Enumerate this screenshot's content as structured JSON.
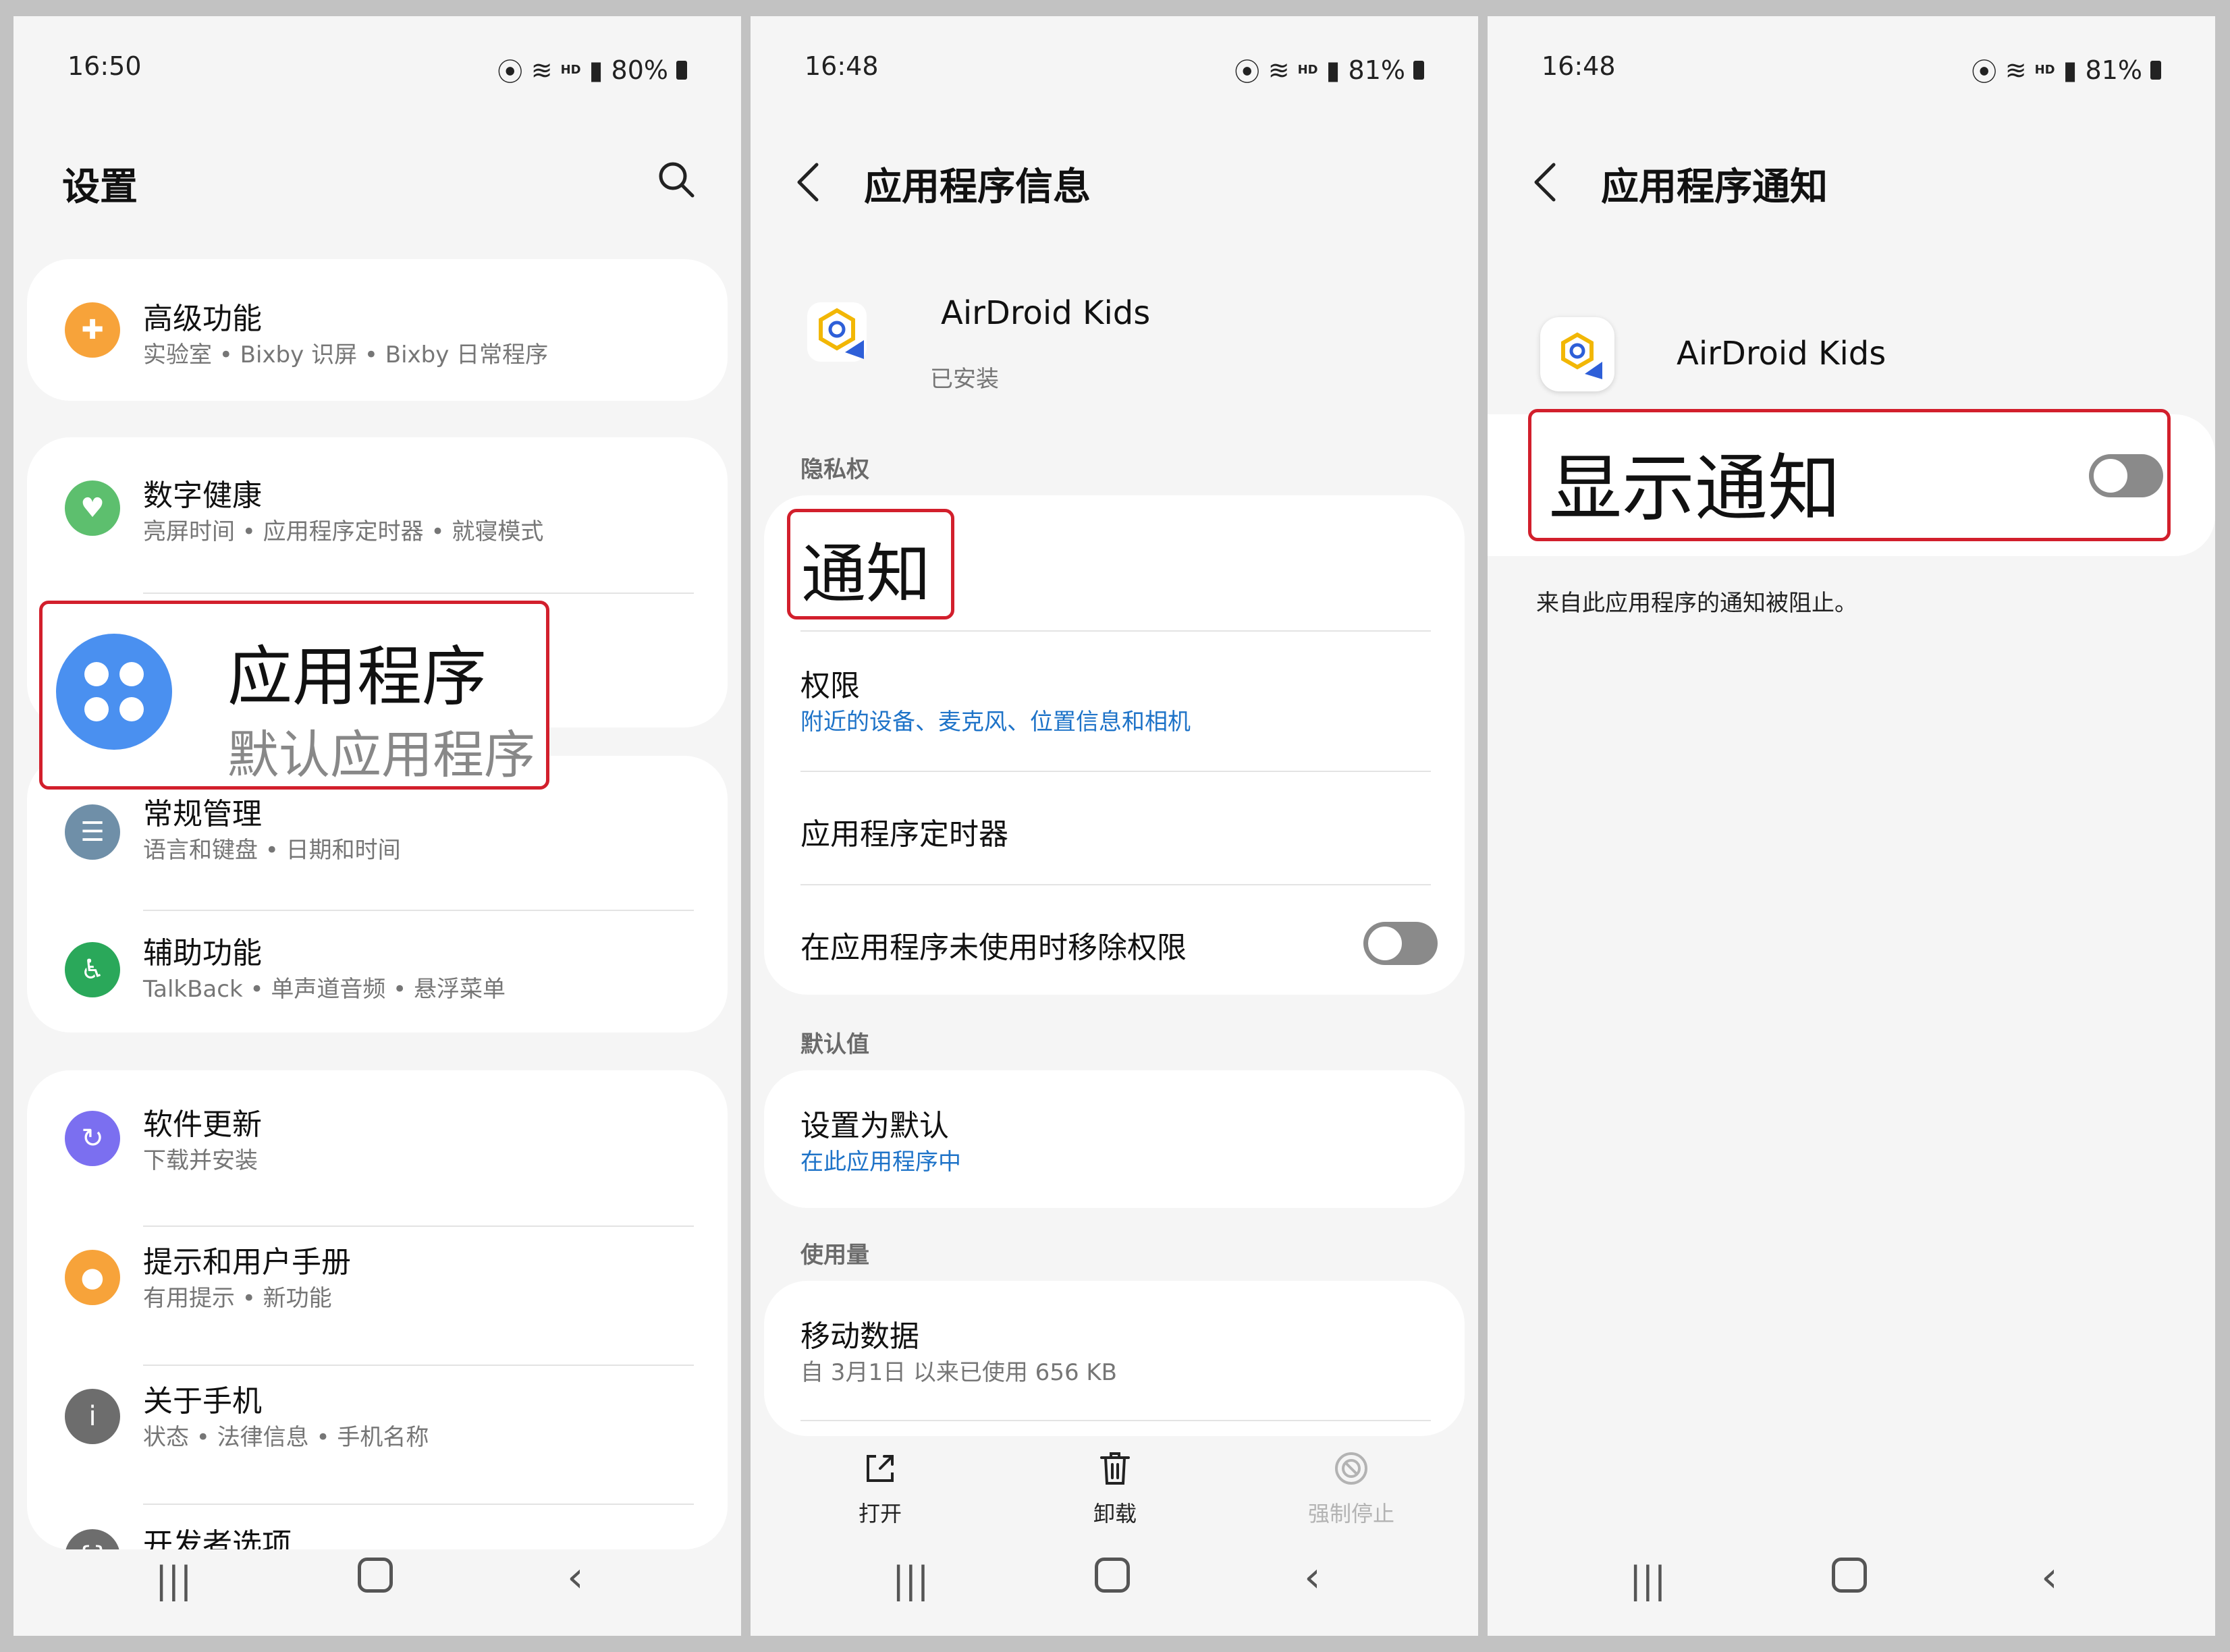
{
  "panels": [
    {
      "status": {
        "time": "16:50",
        "battery": "80%"
      },
      "header": {
        "title": "设置"
      },
      "items": [
        {
          "title": "高级功能",
          "subtitle": "实验室 • Bixby 识屏 • Bixby 日常程序",
          "icon": "plus-gear-icon",
          "color": "#f7a33a"
        },
        {
          "title": "数字健康",
          "subtitle": "亮屏时间 • 应用程序定时器 • 就寝模式",
          "icon": "heart-circle-icon",
          "color": "#5dbf6e"
        },
        {
          "title": "常规管理",
          "subtitle": "语言和键盘 • 日期和时间",
          "icon": "sliders-icon",
          "color": "#6f8fa8"
        },
        {
          "title": "辅助功能",
          "subtitle": "TalkBack • 单声道音频 • 悬浮菜单",
          "icon": "accessibility-icon",
          "color": "#2aa85a"
        },
        {
          "title": "软件更新",
          "subtitle": "下载并安装",
          "icon": "update-icon",
          "color": "#7b6ff0"
        },
        {
          "title": "提示和用户手册",
          "subtitle": "有用提示 • 新功能",
          "icon": "bulb-icon",
          "color": "#f7a33a"
        },
        {
          "title": "关于手机",
          "subtitle": "状态 • 法律信息 • 手机名称",
          "icon": "info-icon",
          "color": "#6d6d6d"
        },
        {
          "title": "开发者选项",
          "subtitle": "",
          "icon": "braces-icon",
          "color": "#6d6d6d"
        }
      ],
      "highlight": {
        "title": "应用程序",
        "subtitle": "默认应用程序",
        "color": "#4a90f0"
      }
    },
    {
      "status": {
        "time": "16:48",
        "battery": "81%"
      },
      "header": {
        "title": "应用程序信息"
      },
      "app": {
        "name": "AirDroid Kids",
        "state": "已安装"
      },
      "sections": {
        "privacy": "隐私权",
        "defaults": "默认值",
        "usage": "使用量"
      },
      "rows": {
        "notifications": "通知",
        "permissions_title": "权限",
        "permissions_sub": "附近的设备、麦克风、位置信息和相机",
        "timer": "应用程序定时器",
        "remove_perms": "在应用程序未使用时移除权限",
        "set_default_title": "设置为默认",
        "set_default_sub": "在此应用程序中",
        "mobile_data_title": "移动数据",
        "mobile_data_sub": "自 3月1日 以来已使用 656 KB"
      },
      "actions": {
        "open": "打开",
        "uninstall": "卸载",
        "force_stop": "强制停止"
      }
    },
    {
      "status": {
        "time": "16:48",
        "battery": "81%"
      },
      "header": {
        "title": "应用程序通知"
      },
      "app": {
        "name": "AirDroid Kids"
      },
      "show_notifications": "显示通知",
      "blocked_msg": "来自此应用程序的通知被阻止。"
    }
  ],
  "colors": {
    "highlight_border": "#d21f2c",
    "link_blue": "#1e73c8"
  }
}
